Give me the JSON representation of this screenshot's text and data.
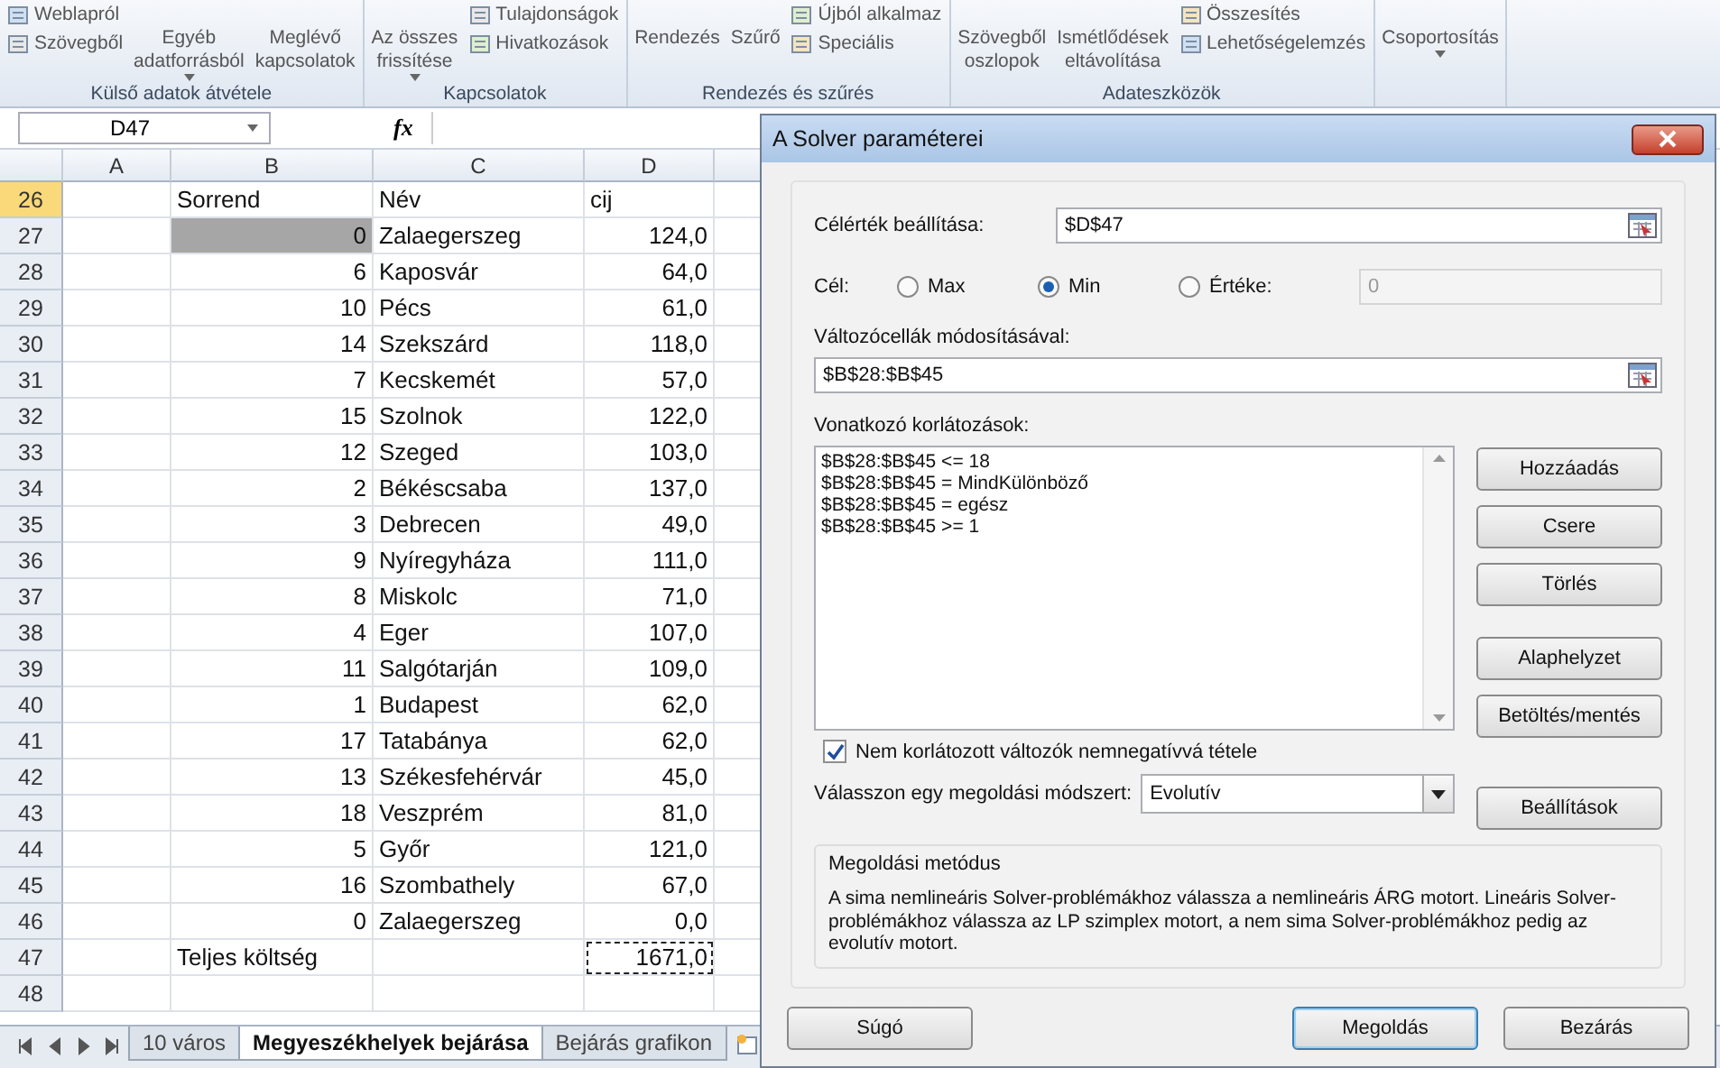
{
  "ribbon": {
    "groups": [
      {
        "label": "Külső adatok átvétele",
        "items": [
          {
            "kind": "stack",
            "labels": [
              "Weblapról",
              "Szövegből"
            ]
          },
          {
            "kind": "large",
            "label": "Egyéb\nadatforrásból",
            "dropdown": true
          },
          {
            "kind": "large",
            "label": "Meglévő\nkapcsolatok",
            "dropdown": false
          }
        ]
      },
      {
        "label": "Kapcsolatok",
        "items": [
          {
            "kind": "large",
            "label": "Az összes\nfrissítése",
            "dropdown": true
          },
          {
            "kind": "stack",
            "labels": [
              "Tulajdonságok",
              "Hivatkozások"
            ]
          }
        ]
      },
      {
        "label": "Rendezés és szűrés",
        "items": [
          {
            "kind": "large",
            "label": "Rendezés",
            "dropdown": false
          },
          {
            "kind": "large",
            "label": "Szűrő",
            "dropdown": false
          },
          {
            "kind": "stack",
            "labels": [
              "Újból alkalmaz",
              "Speciális"
            ]
          }
        ]
      },
      {
        "label": "Adateszközök",
        "items": [
          {
            "kind": "large",
            "label": "Szövegből\noszlopok",
            "dropdown": false
          },
          {
            "kind": "large",
            "label": "Ismétlődések\neltávolítása",
            "dropdown": false
          },
          {
            "kind": "stack",
            "labels": [
              "Összesítés",
              "Lehetőségelemzés"
            ]
          }
        ]
      },
      {
        "items": [
          {
            "kind": "large",
            "label": "Csoportosítás",
            "dropdown": true
          }
        ]
      }
    ]
  },
  "formula_bar": {
    "name_box": "D47",
    "fx": "fx"
  },
  "sheet": {
    "columns": [
      "A",
      "B",
      "C",
      "D"
    ],
    "rows": [
      {
        "row": "26",
        "kind": "header",
        "selected": true,
        "b": "Sorrend",
        "c": "Név",
        "d": "cij"
      },
      {
        "row": "27",
        "kind": "data",
        "selected": false,
        "highlighted": true,
        "b": "0",
        "c": "Zalaegerszeg",
        "d": "124,0"
      },
      {
        "row": "28",
        "kind": "data",
        "selected": false,
        "highlighted": false,
        "b": "6",
        "c": "Kaposvár",
        "d": "64,0"
      },
      {
        "row": "29",
        "kind": "data",
        "selected": false,
        "highlighted": false,
        "b": "10",
        "c": "Pécs",
        "d": "61,0"
      },
      {
        "row": "30",
        "kind": "data",
        "selected": false,
        "highlighted": false,
        "b": "14",
        "c": "Szekszárd",
        "d": "118,0"
      },
      {
        "row": "31",
        "kind": "data",
        "selected": false,
        "highlighted": false,
        "b": "7",
        "c": "Kecskemét",
        "d": "57,0"
      },
      {
        "row": "32",
        "kind": "data",
        "selected": false,
        "highlighted": false,
        "b": "15",
        "c": "Szolnok",
        "d": "122,0"
      },
      {
        "row": "33",
        "kind": "data",
        "selected": false,
        "highlighted": false,
        "b": "12",
        "c": "Szeged",
        "d": "103,0"
      },
      {
        "row": "34",
        "kind": "data",
        "selected": false,
        "highlighted": false,
        "b": "2",
        "c": "Békéscsaba",
        "d": "137,0"
      },
      {
        "row": "35",
        "kind": "data",
        "selected": false,
        "highlighted": false,
        "b": "3",
        "c": "Debrecen",
        "d": "49,0"
      },
      {
        "row": "36",
        "kind": "data",
        "selected": false,
        "highlighted": false,
        "b": "9",
        "c": "Nyíregyháza",
        "d": "111,0"
      },
      {
        "row": "37",
        "kind": "data",
        "selected": false,
        "highlighted": false,
        "b": "8",
        "c": "Miskolc",
        "d": "71,0"
      },
      {
        "row": "38",
        "kind": "data",
        "selected": false,
        "highlighted": false,
        "b": "4",
        "c": "Eger",
        "d": "107,0"
      },
      {
        "row": "39",
        "kind": "data",
        "selected": false,
        "highlighted": false,
        "b": "11",
        "c": "Salgótarján",
        "d": "109,0"
      },
      {
        "row": "40",
        "kind": "data",
        "selected": false,
        "highlighted": false,
        "b": "1",
        "c": "Budapest",
        "d": "62,0"
      },
      {
        "row": "41",
        "kind": "data",
        "selected": false,
        "highlighted": false,
        "b": "17",
        "c": "Tatabánya",
        "d": "62,0"
      },
      {
        "row": "42",
        "kind": "data",
        "selected": false,
        "highlighted": false,
        "b": "13",
        "c": "Székesfehérvár",
        "d": "45,0"
      },
      {
        "row": "43",
        "kind": "data",
        "selected": false,
        "highlighted": false,
        "b": "18",
        "c": "Veszprém",
        "d": "81,0"
      },
      {
        "row": "44",
        "kind": "data",
        "selected": false,
        "highlighted": false,
        "b": "5",
        "c": "Győr",
        "d": "121,0"
      },
      {
        "row": "45",
        "kind": "data",
        "selected": false,
        "highlighted": false,
        "b": "16",
        "c": "Szombathely",
        "d": "67,0"
      },
      {
        "row": "46",
        "kind": "data",
        "selected": false,
        "highlighted": false,
        "b": "0",
        "c": "Zalaegerszeg",
        "d": "0,0"
      },
      {
        "row": "47",
        "kind": "total",
        "selected": false,
        "copy_marquee": true,
        "b": "Teljes költség",
        "d": "1671,0"
      },
      {
        "row": "48",
        "kind": "empty",
        "selected": false
      }
    ],
    "tabs": [
      {
        "label": "10 város",
        "selected": false
      },
      {
        "label": "Megyeszékhelyek bejárása",
        "selected": true
      },
      {
        "label": "Bejárás grafikon",
        "selected": false
      }
    ]
  },
  "dialog": {
    "title": "A Solver paraméterei",
    "objective_label": "Célérték beállítása:",
    "objective_value": "$D$47",
    "goal_label": "Cél:",
    "goal_options": [
      {
        "label": "Max",
        "selected": false
      },
      {
        "label": "Min",
        "selected": true
      },
      {
        "label": "Értéke:",
        "selected": false
      }
    ],
    "value_field": "0",
    "variables_label": "Változócellák módosításával:",
    "variables_value": "$B$28:$B$45",
    "constraints_label": "Vonatkozó korlátozások:",
    "constraints": [
      "$B$28:$B$45 <= 18",
      "$B$28:$B$45 = MindKülönböző",
      "$B$28:$B$45 = egész",
      "$B$28:$B$45 >= 1"
    ],
    "side_buttons": [
      "Hozzáadás",
      "Csere",
      "Törlés",
      "Alaphelyzet",
      "Betöltés/mentés"
    ],
    "nonneg_label": "Nem korlátozott változók nemnegatívvá tétele",
    "nonneg_checked": true,
    "method_label": "Válasszon egy megoldási módszert:",
    "method_value": "Evolutív",
    "options_button": "Beállítások",
    "method_box_title": "Megoldási metódus",
    "method_box_text": "A sima nemlineáris Solver-problémákhoz válassza a nemlineáris ÁRG motort. Lineáris Solver-problémákhoz válassza az LP szimplex motort, a nem sima Solver-problémákhoz pedig az evolutív motort.",
    "bottom_buttons": [
      {
        "label": "Súgó",
        "selected": false
      },
      {
        "label": "Megoldás",
        "selected": true
      },
      {
        "label": "Bezárás",
        "selected": false
      }
    ]
  }
}
